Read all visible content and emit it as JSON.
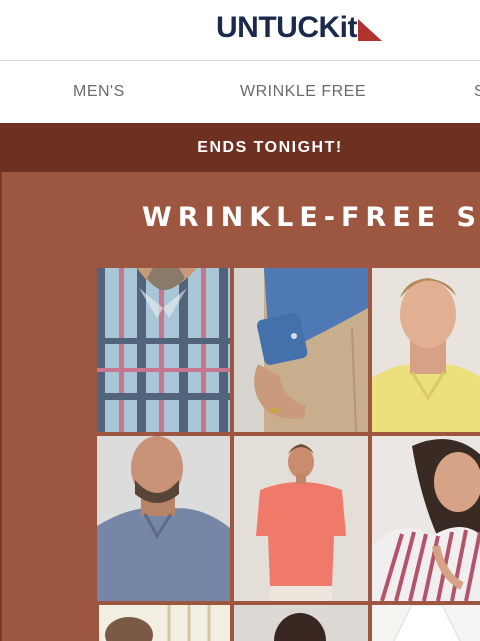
{
  "brand": {
    "name": "UNTUCKit",
    "flag_color": "#b1322f",
    "text_color": "#1b2a4a"
  },
  "nav": {
    "items": [
      "MEN'S",
      "WRINKLE FREE",
      "S"
    ]
  },
  "banner": {
    "text": "ENDS TONIGHT!",
    "bg_color": "#6d3021"
  },
  "hero": {
    "title": "WRINKLE-FREE SALE",
    "bg_color": "#9d563f",
    "tiles": [
      "plaid-shirt-closeup",
      "blue-shirt-cuff-khaki",
      "yellow-polo-man",
      "gray-shirt-man",
      "coral-polo-man",
      "striped-shirt-woman",
      "shirt-partial",
      "man-partial",
      "white-shirt-partial"
    ]
  }
}
